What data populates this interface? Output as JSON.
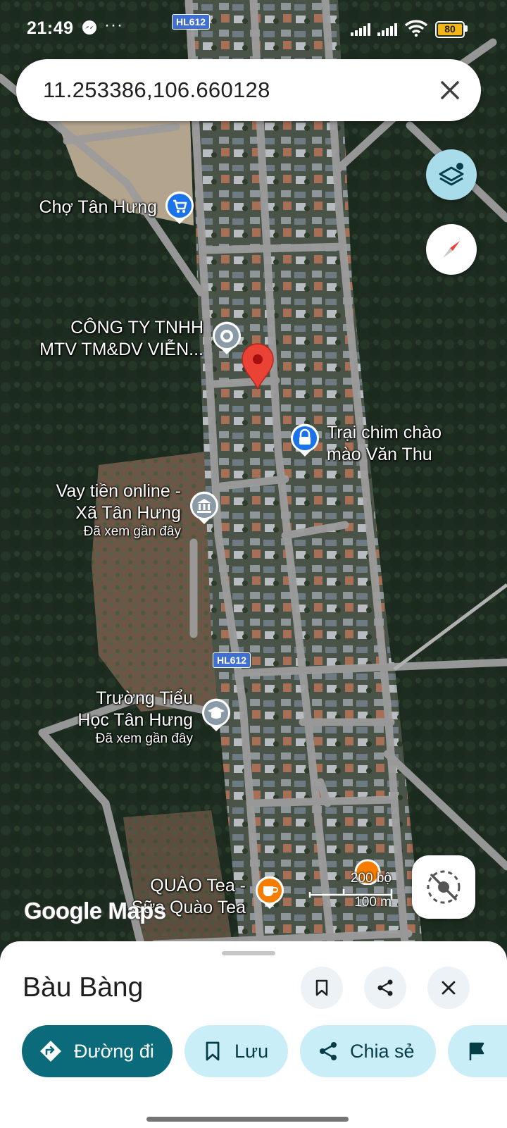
{
  "status_bar": {
    "time": "21:49",
    "more": "···",
    "battery": "80"
  },
  "road_shields": [
    "HL612",
    "HL612"
  ],
  "search": {
    "query": "11.253386,106.660128"
  },
  "map": {
    "labels": [
      {
        "lines": [
          "Chợ Tân Hưng"
        ]
      },
      {
        "lines": [
          "CÔNG TY TNHH",
          "MTV TM&DV VIỄN..."
        ]
      },
      {
        "lines": [
          "Trại chim chào",
          "mào Văn Thu"
        ]
      },
      {
        "lines": [
          "Vay tiền online -",
          "Xã Tân Hưng"
        ],
        "note": "Đã xem gần đây"
      },
      {
        "lines": [
          "Trường Tiểu",
          "Học Tân Hưng"
        ],
        "note": "Đã xem gần đây"
      },
      {
        "lines": [
          "QUÀO Tea -",
          "Sữa Quào Tea"
        ]
      }
    ],
    "scale": {
      "imperial": "200 bộ",
      "metric": "100 m"
    },
    "watermark": "Google Maps",
    "colors": {
      "pin": "#ea4335",
      "poi_blue": "#1a73e8",
      "poi_gray": "#8a9aa7",
      "poi_orange": "#f57c00",
      "road": "#9e9e9e"
    }
  },
  "sheet": {
    "place_name": "Bàu Bàng",
    "chips": {
      "directions": "Đường đi",
      "save": "Lưu",
      "share": "Chia sẻ"
    }
  }
}
